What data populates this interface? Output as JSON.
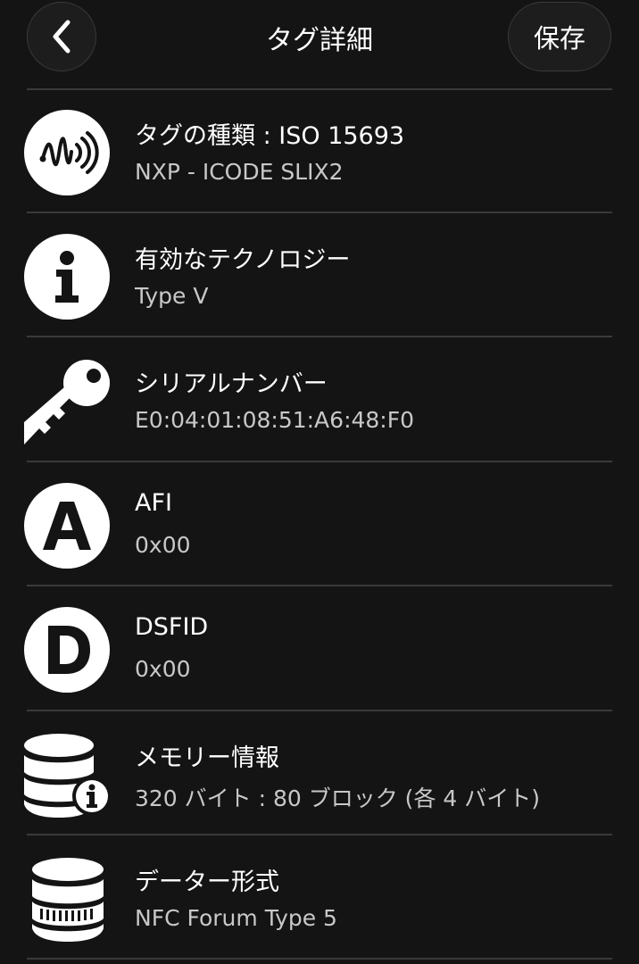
{
  "header": {
    "title": "タグ詳細",
    "save_label": "保存",
    "back_icon": "chevron-left-icon"
  },
  "rows": [
    {
      "icon": "nfc-tag-icon",
      "title": "タグの種類 : ISO 15693",
      "value": "NXP - ICODE SLIX2"
    },
    {
      "icon": "info-icon",
      "title": "有効なテクノロジー",
      "value": "Type V"
    },
    {
      "icon": "key-icon",
      "title": "シリアルナンバー",
      "value": "E0:04:01:08:51:A6:48:F0"
    },
    {
      "icon": "letter-a-icon",
      "title": "AFI",
      "value": "0x00"
    },
    {
      "icon": "letter-d-icon",
      "title": "DSFID",
      "value": "0x00"
    },
    {
      "icon": "database-info-icon",
      "title": "メモリー情報",
      "value": "320 バイト : 80 ブロック (各 4 バイト)"
    },
    {
      "icon": "database-icon",
      "title": "データー形式",
      "value": "NFC Forum Type 5"
    }
  ],
  "colors": {
    "background": "#141414",
    "divider": "#3a3a3a",
    "primary_text": "#ffffff",
    "secondary_text": "#c8c8c8"
  }
}
